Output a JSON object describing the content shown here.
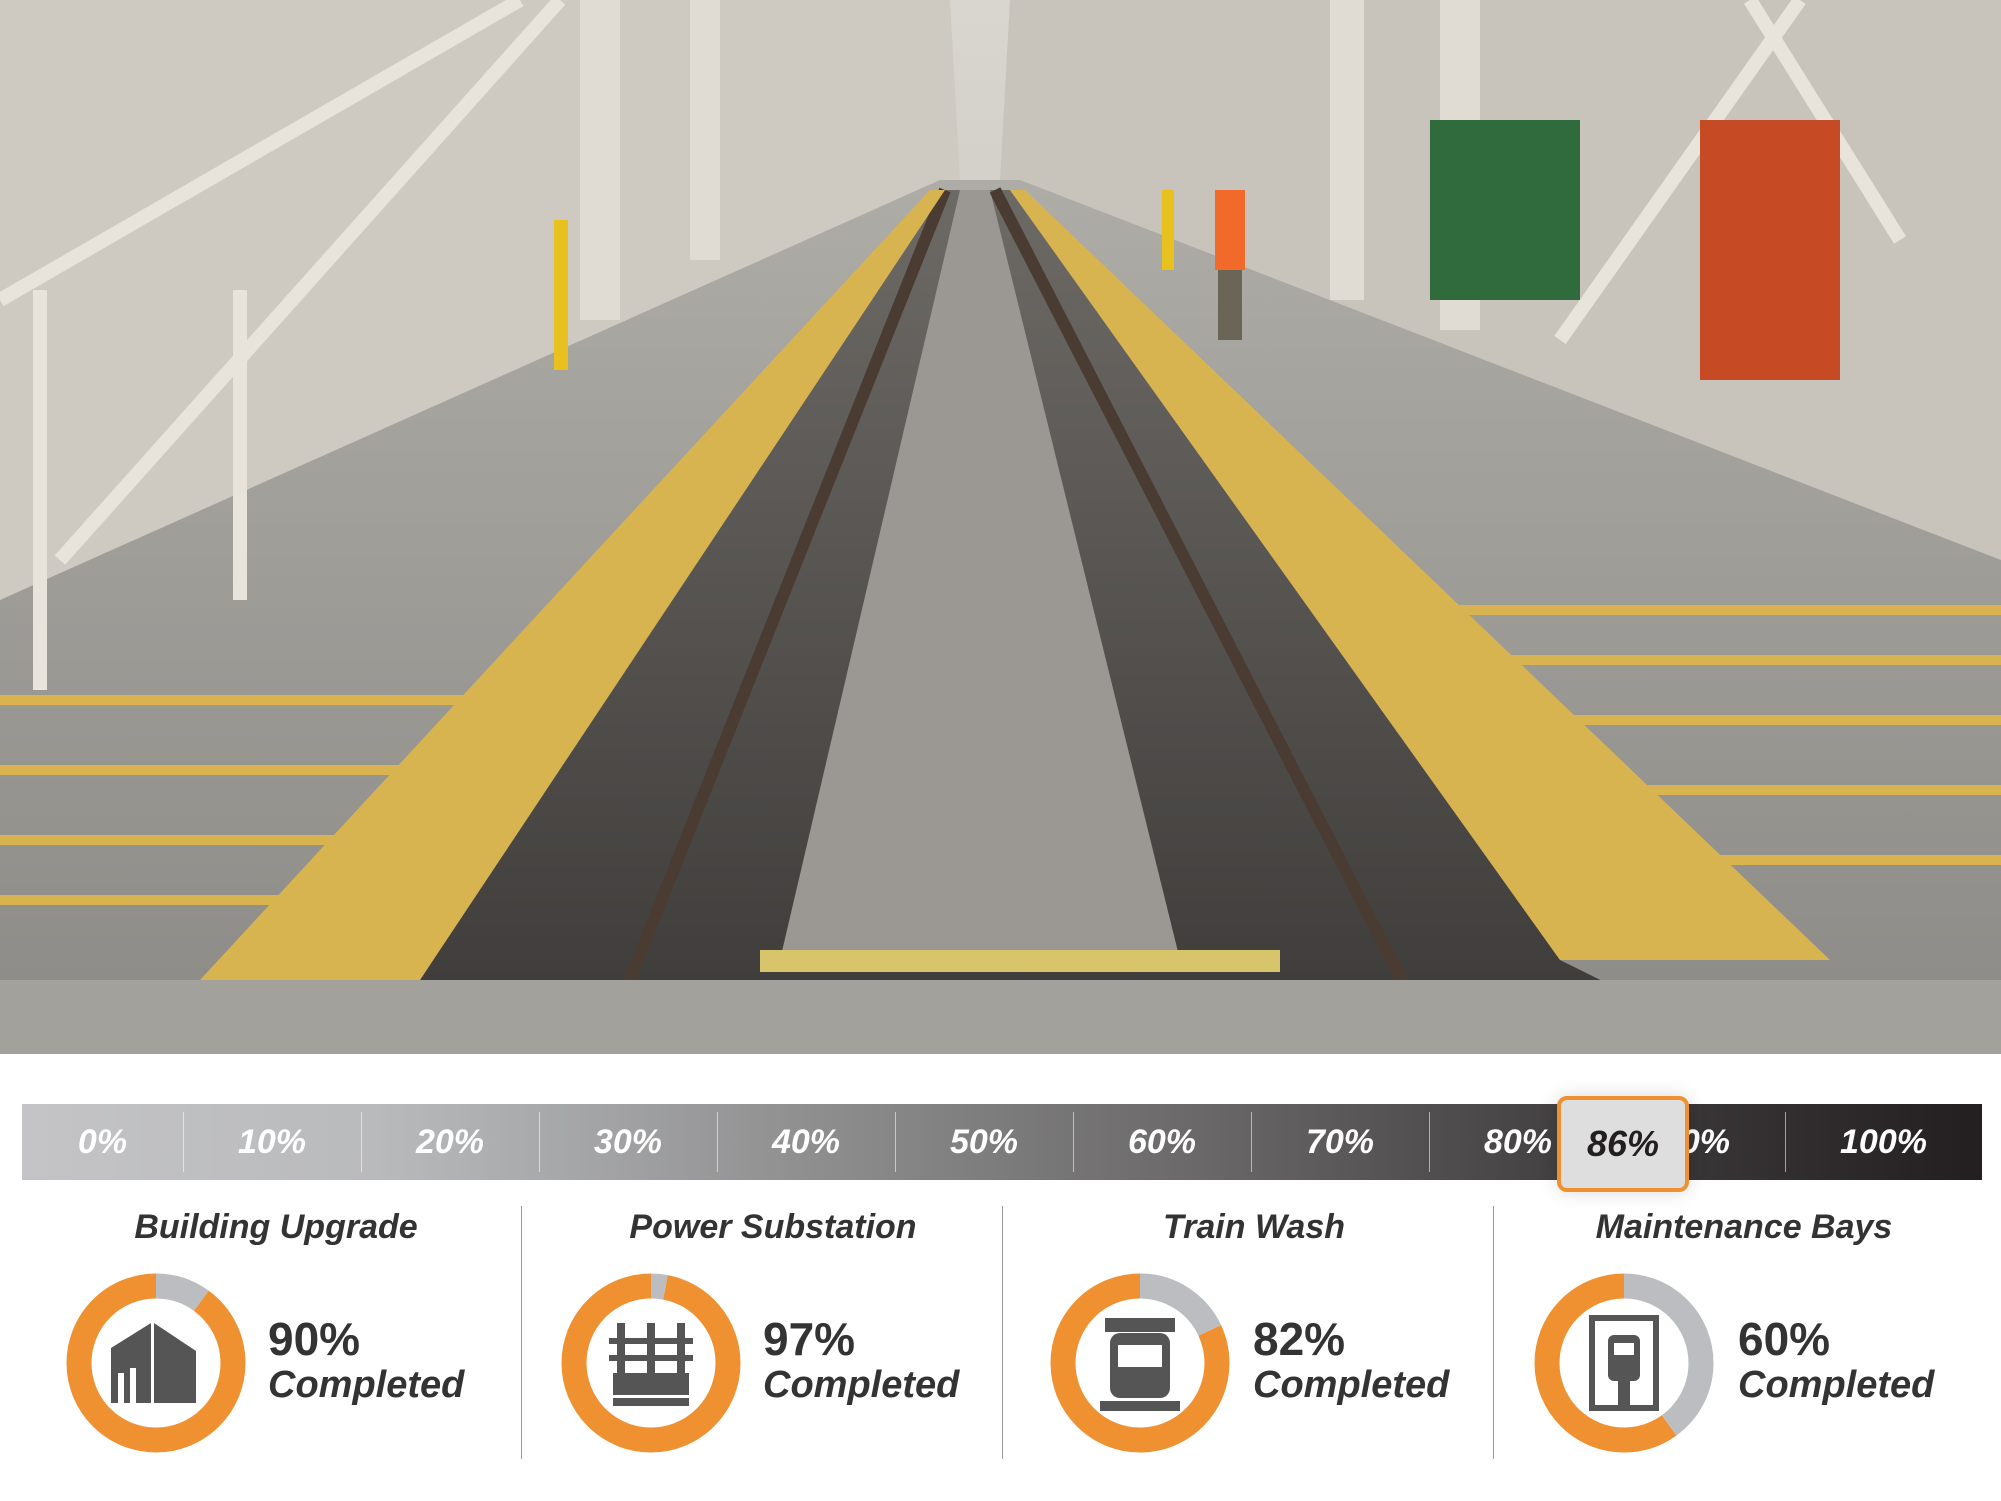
{
  "progress_bar": {
    "ticks": [
      "0%",
      "10%",
      "20%",
      "30%",
      "40%",
      "50%",
      "60%",
      "70%",
      "80%",
      "90%",
      "100%"
    ],
    "current_label": "86%",
    "current_value": 86,
    "marker_color": "#ef9131"
  },
  "projects": [
    {
      "title": "Building Upgrade",
      "percent_label": "90%",
      "status": "Completed",
      "value": 90,
      "icon": "building-icon"
    },
    {
      "title": "Power Substation",
      "percent_label": "97%",
      "status": "Completed",
      "value": 97,
      "icon": "substation-icon"
    },
    {
      "title": "Train Wash",
      "percent_label": "82%",
      "status": "Completed",
      "value": 82,
      "icon": "train-wash-icon"
    },
    {
      "title": "Maintenance Bays",
      "percent_label": "60%",
      "status": "Completed",
      "value": 60,
      "icon": "maintenance-bay-icon"
    }
  ],
  "colors": {
    "complete": "#ef9131",
    "remaining": "#bcbdc0",
    "icon": "#555555"
  }
}
